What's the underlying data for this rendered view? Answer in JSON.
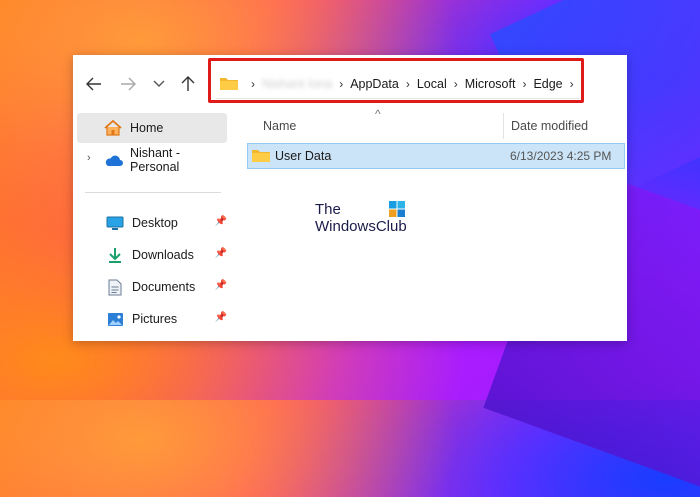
{
  "wallpaper": {
    "colors": [
      "#ff7a1a",
      "#ff3d7a",
      "#c21aff",
      "#4b2bff"
    ]
  },
  "toolbar": {
    "back_icon": "arrow-left-icon",
    "forward_icon": "arrow-right-icon",
    "recent_icon": "chevron-down-icon",
    "up_icon": "arrow-up-icon"
  },
  "address_bar": {
    "folder_icon": "folder-icon",
    "crumbs": [
      "Nishant Iona",
      "AppData",
      "Local",
      "Microsoft",
      "Edge"
    ],
    "highlight_color": "#e01919"
  },
  "sidebar": {
    "home": {
      "label": "Home",
      "icon": "home-icon"
    },
    "onedrive": {
      "label": "Nishant - Personal",
      "icon": "cloud-icon"
    },
    "quick_access": [
      {
        "label": "Desktop",
        "icon": "desktop-icon"
      },
      {
        "label": "Downloads",
        "icon": "download-icon"
      },
      {
        "label": "Documents",
        "icon": "document-icon"
      },
      {
        "label": "Pictures",
        "icon": "picture-icon"
      }
    ]
  },
  "file_list": {
    "columns": {
      "name": "Name",
      "date_modified": "Date modified"
    },
    "rows": [
      {
        "name": "User Data",
        "date_modified": "6/13/2023 4:25 PM",
        "icon": "folder-icon",
        "selected": true
      }
    ]
  },
  "watermark": {
    "line1": "The",
    "line2": "WindowsClub"
  }
}
